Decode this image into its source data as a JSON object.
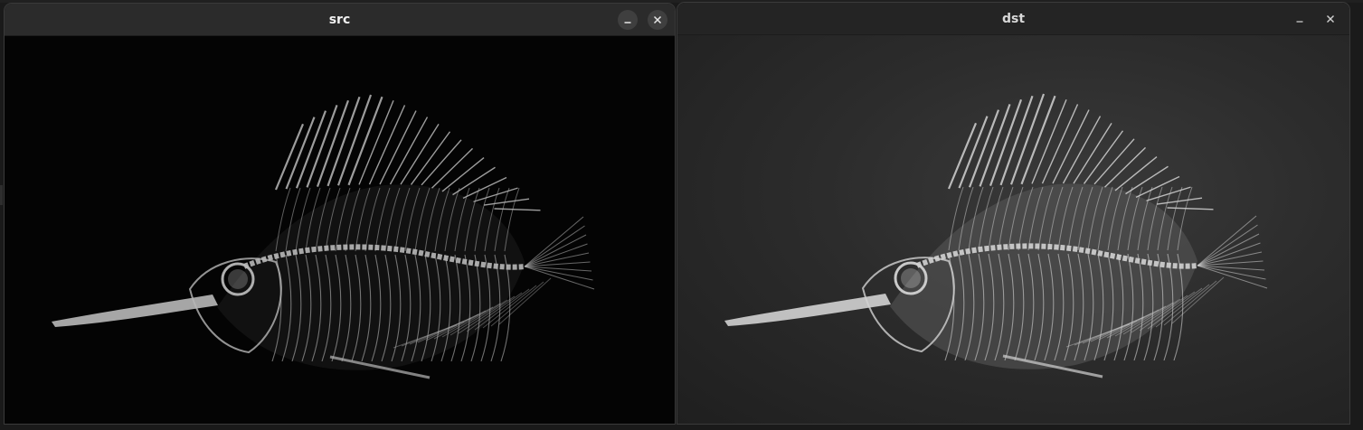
{
  "windows": {
    "src": {
      "title": "src",
      "icons": {
        "minimize": "minimize-icon",
        "close": "close-icon"
      },
      "image": "fish-skeleton-xray-original"
    },
    "dst": {
      "title": "dst",
      "icons": {
        "minimize": "minimize-icon",
        "close": "close-icon"
      },
      "image": "fish-skeleton-xray-enhanced"
    }
  },
  "colors": {
    "titlebar": "#2b2b2b",
    "src_background": "#040404",
    "dst_background": "#2c2c2c",
    "bone": "#bdbdbd"
  }
}
